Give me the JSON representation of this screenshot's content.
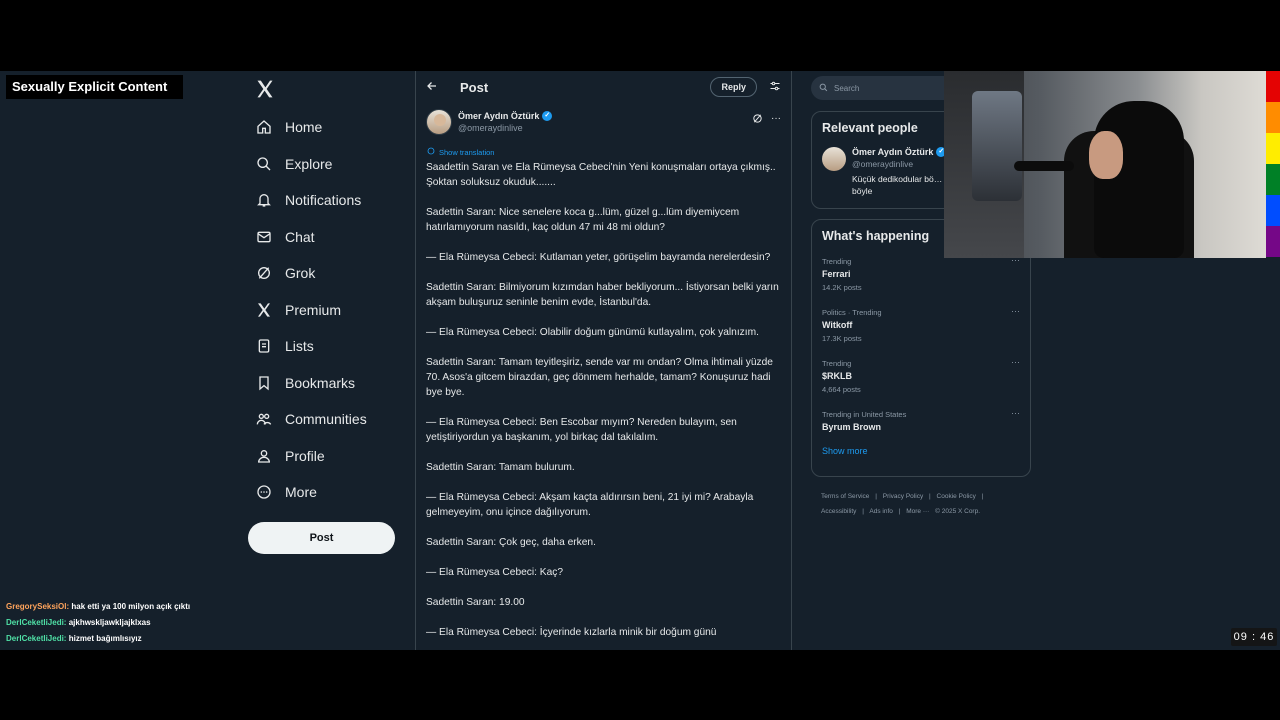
{
  "overlay": {
    "label": "Sexually Explicit Content"
  },
  "nav": {
    "items": [
      {
        "label": "Home",
        "icon": "home-icon"
      },
      {
        "label": "Explore",
        "icon": "search-icon"
      },
      {
        "label": "Notifications",
        "icon": "bell-icon"
      },
      {
        "label": "Chat",
        "icon": "mail-icon"
      },
      {
        "label": "Grok",
        "icon": "grok-icon"
      },
      {
        "label": "Premium",
        "icon": "x-icon"
      },
      {
        "label": "Lists",
        "icon": "list-icon"
      },
      {
        "label": "Bookmarks",
        "icon": "bookmark-icon"
      },
      {
        "label": "Communities",
        "icon": "people-icon"
      },
      {
        "label": "Profile",
        "icon": "person-icon"
      },
      {
        "label": "More",
        "icon": "more-circle-icon"
      }
    ],
    "post_button": "Post"
  },
  "chat": {
    "lines": [
      {
        "user": "GregorySeksiOl:",
        "msg": "hak etti ya 100 milyon açık çıktı",
        "color": "#ffa45c"
      },
      {
        "user": "DerlCeketliJedi:",
        "msg": "ajkhwskljawkljajklxas",
        "color": "#4fe0a6"
      },
      {
        "user": "DerlCeketliJedi:",
        "msg": "hizmet bağımlısıyız",
        "color": "#4fe0a6"
      }
    ]
  },
  "main": {
    "title": "Post",
    "reply_label": "Reply",
    "author": {
      "name": "Ömer Aydın Öztürk",
      "handle": "@omeraydinlive"
    },
    "show_translation": "Show translation",
    "paragraphs": [
      "Saadettin Saran ve Ela Rümeysa Cebeci'nin   Yeni konuşmaları ortaya çıkmış.. Şoktan soluksuz okuduk.......",
      "Sadettin Saran: Nice senelere koca g...lüm, güzel g...lüm diyemiycem hatırlamıyorum nasıldı, kaç oldun 47 mi 48 mi oldun?",
      "— Ela Rümeysa Cebeci: Kutlaman yeter, görüşelim bayramda nerelerdesin?",
      "Sadettin Saran: Bilmiyorum kızımdan haber bekliyorum... İstiyorsan belki yarın akşam buluşuruz seninle benim evde, İstanbul'da.",
      "— Ela Rümeysa Cebeci: Olabilir doğum günümü kutlayalım, çok yalnızım.",
      "Sadettin Saran: Tamam teyitleşiriz, sende var mı ondan? Olma ihtimali yüzde 70. Asos'a gitcem birazdan, geç dönmem herhalde, tamam? Konuşuruz hadi bye bye.",
      "— Ela Rümeysa Cebeci: Ben Escobar mıyım? Nereden bulayım, sen yetiştiriyordun ya başkanım, yol birkaç dal takılalım.",
      "Sadettin Saran: Tamam bulurum.",
      "— Ela Rümeysa Cebeci: Akşam kaçta aldırırsın beni, 21 iyi mi? Arabayla gelmeyeyim, onu içince dağılıyorum.",
      "Sadettin Saran: Çok geç, daha erken.",
      "— Ela Rümeysa Cebeci: Kaç?",
      "Sadettin Saran: 19.00",
      "— Ela Rümeysa Cebeci: İçyerinde kızlarla minik bir doğum günü"
    ]
  },
  "sidebar": {
    "search_placeholder": "Search",
    "relevant": {
      "title": "Relevant people",
      "name": "Ömer Aydın Öztürk",
      "handle": "@omeraydinlive",
      "bio": "Küçük dedikodular bö… skandallar asla böyle"
    },
    "happening": {
      "title": "What's happening",
      "trends": [
        {
          "meta": "Trending",
          "topic": "Ferrari",
          "count": "14.2K posts"
        },
        {
          "meta": "Politics · Trending",
          "topic": "Witkoff",
          "count": "17.3K posts"
        },
        {
          "meta": "Trending",
          "topic": "$RKLB",
          "count": "4,664 posts"
        },
        {
          "meta": "Trending in United States",
          "topic": "Byrum Brown",
          "count": ""
        }
      ],
      "show_more": "Show more"
    },
    "footer": {
      "links": [
        "Terms of Service",
        "|",
        "Privacy Policy",
        "|",
        "Cookie Policy",
        "|",
        "Accessibility",
        "|",
        "Ads info",
        "|",
        "More ···",
        "© 2025 X Corp."
      ]
    }
  },
  "timer": "09 : 46",
  "colors": {
    "background": "#15202b",
    "accent": "#1d9bf0",
    "rainbow": [
      "#e40303",
      "#ff8c00",
      "#ffed00",
      "#008026",
      "#004dff",
      "#750787"
    ]
  }
}
